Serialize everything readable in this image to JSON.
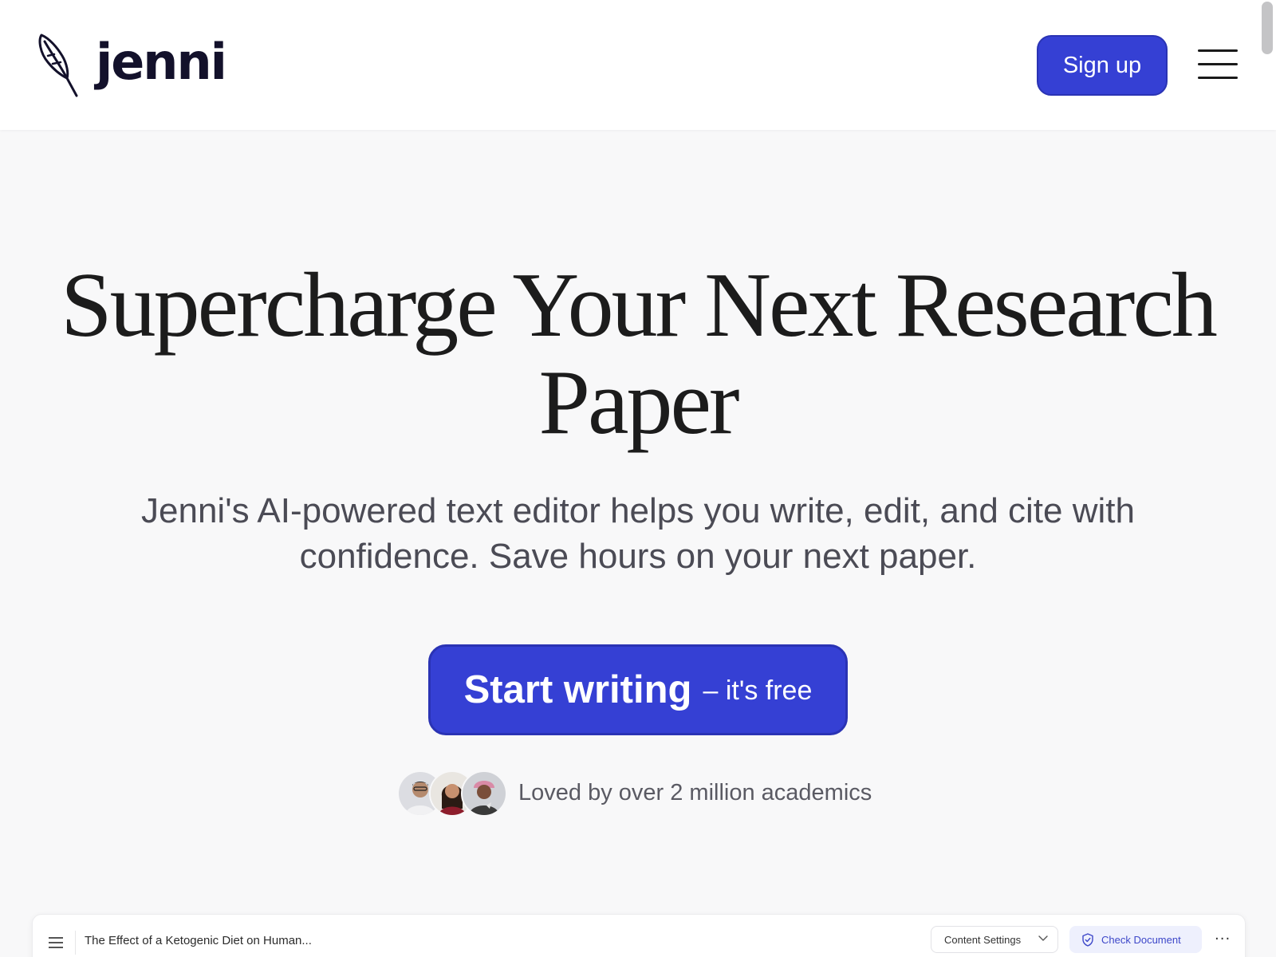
{
  "header": {
    "logo_text": "jenni",
    "signup_label": "Sign up"
  },
  "hero": {
    "title": "Supercharge Your Next Research Paper",
    "subtitle": "Jenni's AI-powered text editor helps you write, edit, and cite with confidence. Save hours on your next paper.",
    "cta_main": "Start writing",
    "cta_sub": "– it's free",
    "social_proof": "Loved by over 2 million academics"
  },
  "preview": {
    "doc_title": "The Effect of a Ketogenic Diet on Human...",
    "content_settings_label": "Content Settings",
    "check_document_label": "Check Document",
    "more_label": "···"
  },
  "colors": {
    "brand": "#3540d4",
    "brand_border": "#2a33b4",
    "logo_text": "#13112b",
    "page_bg": "#f8f8f9",
    "check_doc_bg": "#eef0fd",
    "check_doc_text": "#3d47c9"
  },
  "icons": {
    "logo": "feather-quill-icon",
    "menu": "hamburger-menu-icon",
    "preview_menu": "hamburger-menu-icon",
    "dropdown": "chevron-down-icon",
    "check": "shield-check-icon",
    "more": "more-horizontal-icon"
  }
}
